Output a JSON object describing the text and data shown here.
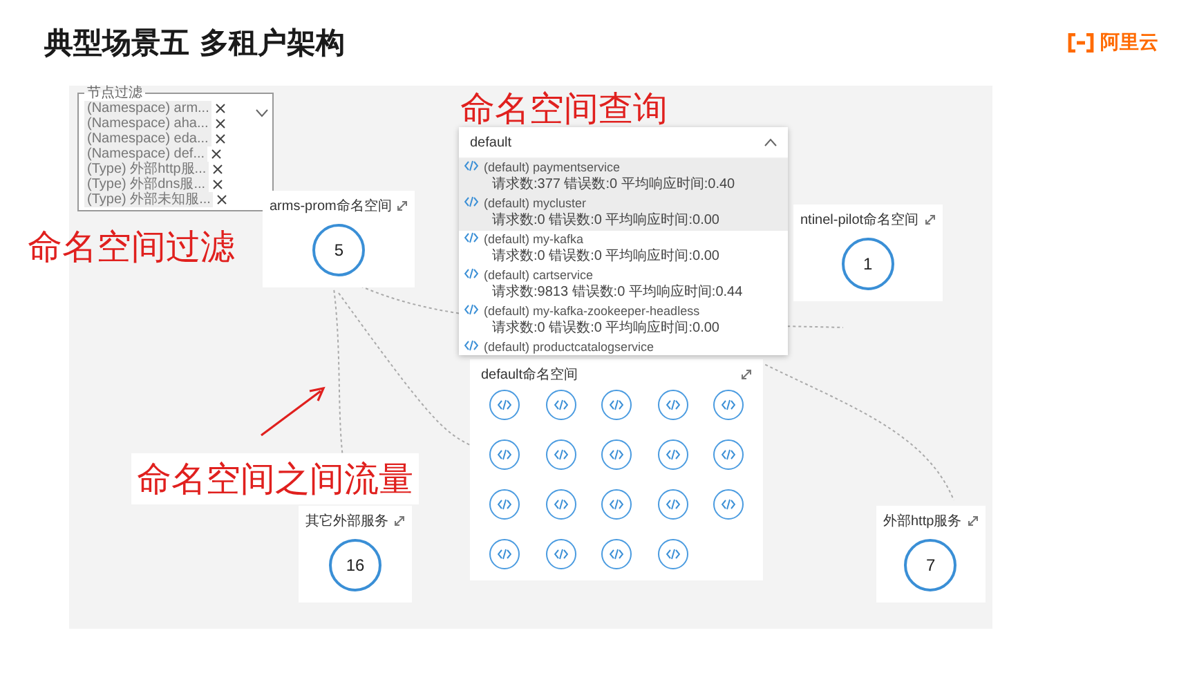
{
  "slide": {
    "title": "典型场景五 多租户架构",
    "logo_text": "阿里云"
  },
  "filter": {
    "legend": "节点过滤",
    "tags": [
      {
        "label": "(Namespace) arm..."
      },
      {
        "label": "(Namespace) aha..."
      },
      {
        "label": "(Namespace) eda..."
      },
      {
        "label": "(Namespace) def..."
      },
      {
        "label": "(Type) 外部http服..."
      },
      {
        "label": "(Type) 外部dns服..."
      },
      {
        "label": "(Type) 外部未知服..."
      }
    ]
  },
  "search": {
    "value": "default",
    "results": [
      {
        "name": "(default) paymentservice",
        "stats": "请求数:377  错误数:0  平均响应时间:0.40",
        "highlighted": true
      },
      {
        "name": "(default) mycluster",
        "stats": "请求数:0  错误数:0  平均响应时间:0.00",
        "highlighted": true
      },
      {
        "name": "(default) my-kafka",
        "stats": "请求数:0  错误数:0  平均响应时间:0.00",
        "highlighted": false
      },
      {
        "name": "(default) cartservice",
        "stats": "请求数:9813  错误数:0  平均响应时间:0.44",
        "highlighted": false
      },
      {
        "name": "(default) my-kafka-zookeeper-headless",
        "stats": "请求数:0  错误数:0  平均响应时间:0.00",
        "highlighted": false
      },
      {
        "name": "(default) productcatalogservice",
        "highlighted": false
      }
    ]
  },
  "namespace_cards": [
    {
      "title": "arms-prom命名空间",
      "count": "5"
    },
    {
      "title": "ntinel-pilot命名空间",
      "count": "1"
    },
    {
      "title": "其它外部服务",
      "count": "16"
    },
    {
      "title": "外部http服务",
      "count": "7"
    }
  ],
  "default_group": {
    "title": "default命名空间",
    "nodes": [
      {
        "kind": "service"
      },
      {
        "kind": "service"
      },
      {
        "kind": "service"
      },
      {
        "kind": "service"
      },
      {
        "kind": "service"
      },
      {
        "kind": "service"
      },
      {
        "kind": "service"
      },
      {
        "kind": "service"
      },
      {
        "kind": "service"
      },
      {
        "kind": "service"
      },
      {
        "kind": "service"
      },
      {
        "kind": "service"
      },
      {
        "kind": "service"
      },
      {
        "kind": "service"
      },
      {
        "kind": "service"
      },
      {
        "kind": "service"
      },
      {
        "kind": "service"
      },
      {
        "kind": "service"
      },
      {
        "kind": "service"
      }
    ]
  },
  "annotations": [
    {
      "text": "命名空间查询",
      "kind": "plain"
    },
    {
      "text": "命名空间过滤",
      "kind": "plain"
    },
    {
      "text": "命名空间之间流量",
      "kind": "boxed"
    }
  ]
}
